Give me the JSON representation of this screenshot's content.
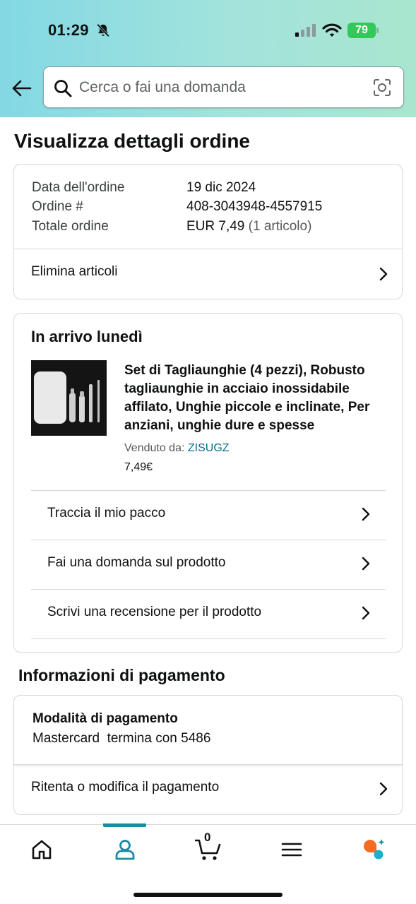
{
  "status_bar": {
    "time": "01:29",
    "battery": "79"
  },
  "search": {
    "placeholder": "Cerca o fai una domanda"
  },
  "page_title": "Visualizza dettagli ordine",
  "order_info": {
    "rows": [
      {
        "label": "Data dell'ordine",
        "value": "19 dic 2024"
      },
      {
        "label": "Ordine #",
        "value": "408-3043948-4557915"
      },
      {
        "label": "Totale ordine",
        "value": "EUR 7,49",
        "extra": "(1 articolo)"
      }
    ],
    "action": "Elimina articoli"
  },
  "shipment": {
    "title": "In arrivo lunedì",
    "product_title": "Set di Tagliaunghie (4 pezzi), Robusto tagliaunghie in acciaio inossidabile affilato, Unghie piccole e inclinate, Per anziani, unghie dure e spesse",
    "seller_label": "Venduto da:",
    "seller_name": "ZISUGZ",
    "price": "7,49€",
    "actions": [
      "Traccia il mio pacco",
      "Fai una domanda sul prodotto",
      "Scrivi una recensione per il prodotto"
    ]
  },
  "payment": {
    "title": "Informazioni di pagamento",
    "method_label": "Modalità di pagamento",
    "method_value": "Mastercard  termina con 5486",
    "action": "Ritenta o modifica il pagamento"
  },
  "tabbar": {
    "cart_count": "0",
    "accent_color": "#1a8aa6"
  },
  "icons": [
    "bell-slash-icon",
    "signal-icon",
    "wifi-icon",
    "battery-icon",
    "back-arrow-icon",
    "search-icon",
    "camera-icon",
    "chevron-right-icon",
    "home-icon",
    "account-icon",
    "cart-icon",
    "menu-icon",
    "rufus-icon"
  ]
}
